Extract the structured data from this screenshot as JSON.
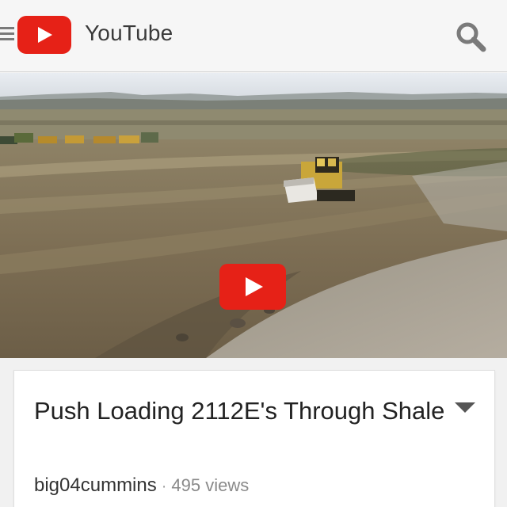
{
  "header": {
    "brand": "YouTube",
    "icons": {
      "menu": "menu-icon",
      "logo": "youtube-logo-icon",
      "search": "search-icon"
    }
  },
  "video": {
    "play_icon": "play-icon"
  },
  "info": {
    "title": "Push Loading 2112E's Through Shale",
    "channel": "big04cummins",
    "separator": "·",
    "views": "495 views",
    "expand_icon": "chevron-down-icon"
  },
  "colors": {
    "brand_red": "#e62117",
    "header_bg": "#f6f6f6",
    "text_primary": "#222222",
    "text_secondary": "#8a8a8a",
    "icon_gray": "#7a7a7a"
  }
}
